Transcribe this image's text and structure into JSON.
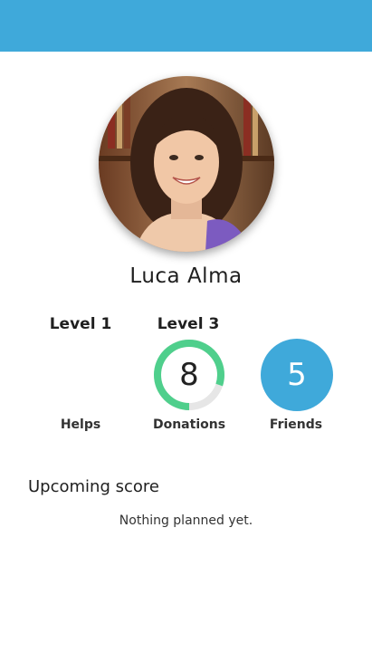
{
  "colors": {
    "header": "#3fa9da",
    "ring_progress": "#4fcf8c",
    "ring_track": "#e6e6e6",
    "friends_circle": "#3fa9da"
  },
  "profile": {
    "name": "Luca Alma",
    "avatar_icon": "user-photo"
  },
  "stats": {
    "helps": {
      "level": "Level 1",
      "label": "Helps"
    },
    "donations": {
      "level": "Level 3",
      "label": "Donations",
      "count": "8",
      "progress": 0.8
    },
    "friends": {
      "label": "Friends",
      "count": "5"
    }
  },
  "upcoming": {
    "title": "Upcoming score",
    "empty_message": "Nothing planned yet."
  }
}
